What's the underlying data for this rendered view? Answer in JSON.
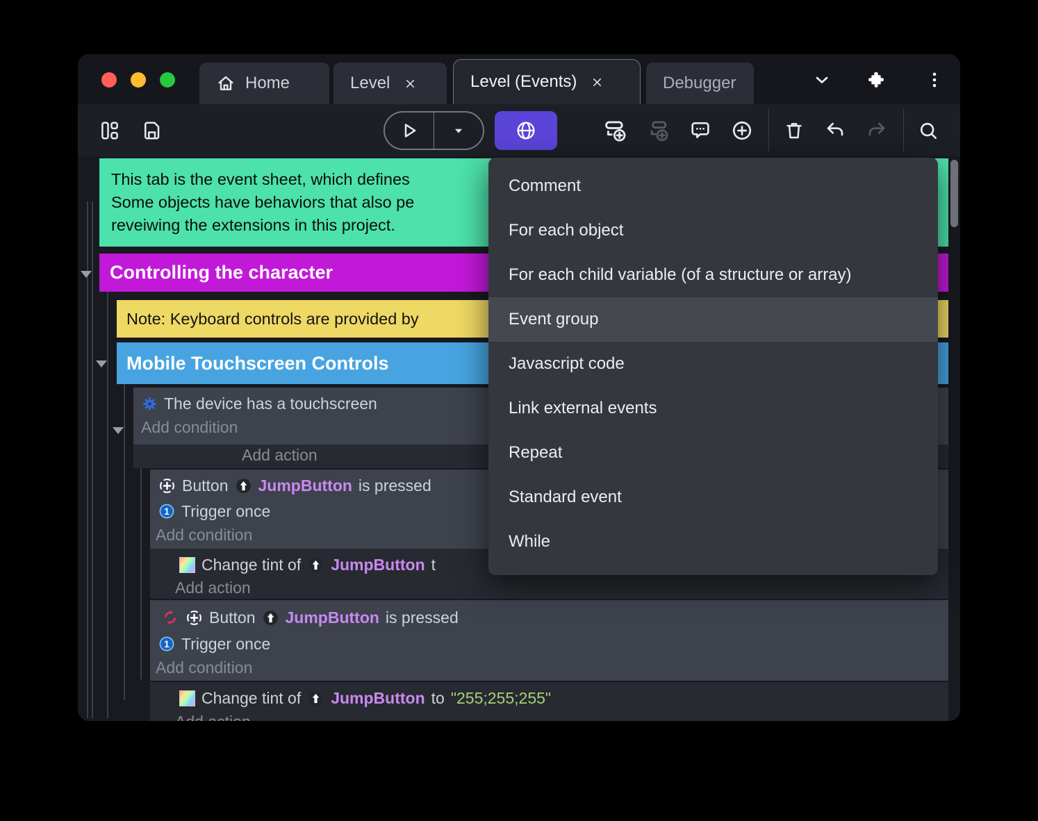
{
  "colors": {
    "accent_indigo": "#5b44d8",
    "comment_green": "#4de1ab",
    "group_magenta": "#c219d9",
    "note_yellow": "#eed964",
    "group_blue": "#47a4e0",
    "object_purple": "#c989ef",
    "string_green": "#a8cf78",
    "traffic_red": "#ff5f57",
    "traffic_yellow": "#febc2e",
    "traffic_green": "#28c840"
  },
  "titlebar": {
    "tabs": [
      {
        "label": "Home"
      },
      {
        "label": "Level"
      },
      {
        "label": "Level (Events)"
      },
      {
        "label": "Debugger"
      }
    ]
  },
  "context_menu": {
    "items": [
      "Comment",
      "For each object",
      "For each child variable (of a structure or array)",
      "Event group",
      "Javascript code",
      "Link external events",
      "Repeat",
      "Standard event",
      "While"
    ],
    "highlighted": "Event group"
  },
  "sheet": {
    "comment": {
      "line1": "This tab is the event sheet, which defines",
      "line2": "Some objects have behaviors that also pe",
      "line3": "reveiwing the extensions in this project."
    },
    "group_controlling": "Controlling the character",
    "note_keyboard": "Note: Keyboard controls are provided by",
    "group_mobile": "Mobile Touchscreen Controls",
    "labels": {
      "add_condition": "Add condition",
      "add_action": "Add action"
    },
    "event_touch": {
      "condition": "The device has a touchscreen"
    },
    "event_jump1": {
      "object": "Button",
      "instance": "JumpButton",
      "suffix": "is pressed",
      "trigger": "Trigger once"
    },
    "action_tint1": {
      "prefix": "Change tint of",
      "instance": "JumpButton",
      "suffix": "t"
    },
    "event_jump2": {
      "object": "Button",
      "instance": "JumpButton",
      "suffix": "is pressed",
      "trigger": "Trigger once"
    },
    "action_tint2": {
      "prefix": "Change tint of",
      "instance": "JumpButton",
      "to": "to",
      "value": "\"255;255;255\""
    }
  }
}
